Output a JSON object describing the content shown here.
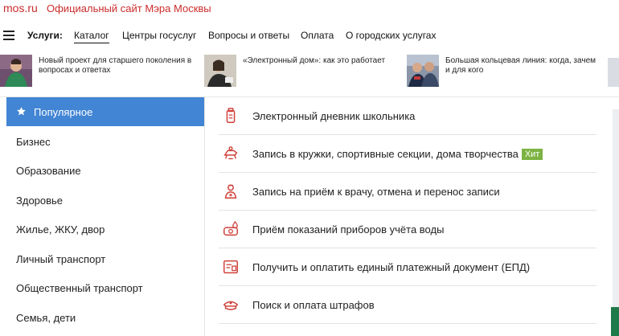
{
  "brand": {
    "site": "mos.ru",
    "title": "Официальный сайт Мэра Москвы"
  },
  "nav": {
    "label": "Услуги:",
    "items": [
      "Каталог",
      "Центры госуслуг",
      "Вопросы и ответы",
      "Оплата",
      "О городских услугах"
    ],
    "active": "Каталог"
  },
  "news": [
    {
      "title": "Новый проект для старшего поколения в вопросах и ответах",
      "line1": "Новый проект для старшего поколения в",
      "line2": "вопросах и ответах"
    },
    {
      "title": "«Электронный дом»: как это работает",
      "line1": "«Электронный дом»: как это работает",
      "line2": ""
    },
    {
      "title": "Большая кольцевая линия: когда, зачем и для кого",
      "line1": "Большая кольцевая линия: когда, зачем",
      "line2": "и для кого"
    }
  ],
  "sidebar": {
    "items": [
      {
        "label": "Популярное",
        "active": true,
        "icon": "star-icon"
      },
      {
        "label": "Бизнес"
      },
      {
        "label": "Образование"
      },
      {
        "label": "Здоровье"
      },
      {
        "label": "Жилье, ЖКУ, двор"
      },
      {
        "label": "Личный транспорт"
      },
      {
        "label": "Общественный транспорт"
      },
      {
        "label": "Семья, дети"
      }
    ]
  },
  "services": [
    {
      "label": "Электронный дневник школьника",
      "icon": "school-diary-icon",
      "badge": ""
    },
    {
      "label": "Запись в кружки, спортивные секции, дома творчества",
      "icon": "clubs-icon",
      "badge": "Хит"
    },
    {
      "label": "Запись на приём к врачу, отмена и перенос записи",
      "icon": "doctor-icon",
      "badge": ""
    },
    {
      "label": "Приём показаний приборов учёта воды",
      "icon": "water-meter-icon",
      "badge": ""
    },
    {
      "label": "Получить и оплатить единый платежный документ (ЕПД)",
      "icon": "payment-document-icon",
      "badge": ""
    },
    {
      "label": "Поиск и оплата штрафов",
      "icon": "police-cap-icon",
      "badge": ""
    }
  ],
  "colors": {
    "brand_red": "#cc2b2b",
    "accent_blue": "#4285d4",
    "hit_green": "#7cb342",
    "icon_red": "#d0403a"
  }
}
